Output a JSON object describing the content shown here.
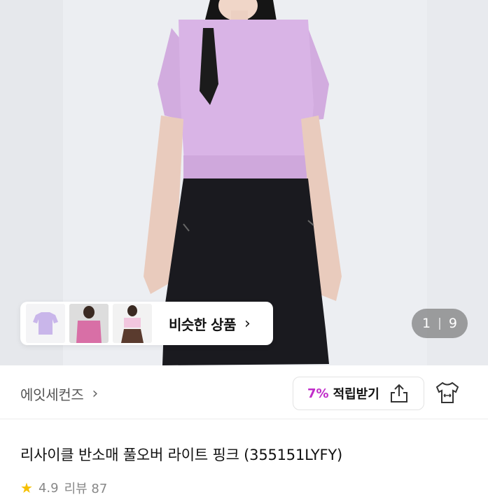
{
  "gallery": {
    "counter_current": "1",
    "counter_separator": "|",
    "counter_total": "9",
    "similar_label": "비슷한 상품",
    "similar_chevron": "›"
  },
  "brand": {
    "name": "에잇세컨즈",
    "chevron": "›"
  },
  "reward": {
    "percent": "7%",
    "label": "적립받기",
    "icon": "share-icon"
  },
  "product": {
    "title": "리사이클 반소매 풀오버  라이트 핑크 (355151LYFY)",
    "rating": "4.9",
    "reviews": "리뷰 87"
  },
  "colors": {
    "accent": "#c02cc9",
    "sweater": "#d9b4e6",
    "skirt": "#1a1a1f"
  }
}
